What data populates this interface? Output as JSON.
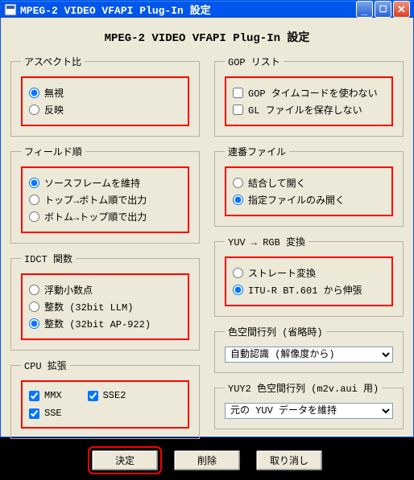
{
  "window": {
    "title": "MPEG-2 VIDEO VFAPI Plug-In 設定"
  },
  "page_title": "MPEG-2 VIDEO VFAPI Plug-In 設定",
  "aspect": {
    "legend": "アスペクト比",
    "opt_ignore": "無視",
    "opt_reflect": "反映"
  },
  "field_order": {
    "legend": "フィールド順",
    "opt_source": "ソースフレームを維持",
    "opt_tb": "トップ→ボトム順で出力",
    "opt_bt": "ボトム→トップ順で出力"
  },
  "idct": {
    "legend": "IDCT 関数",
    "opt_float": "浮動小数点",
    "opt_int32llm": "整数 (32bit LLM)",
    "opt_int32ap": "整数 (32bit AP-922)"
  },
  "cpu": {
    "legend": "CPU 拡張",
    "mmx": "MMX",
    "sse2": "SSE2",
    "sse": "SSE"
  },
  "gop": {
    "legend": "GOP リスト",
    "no_timecode": "GOP タイムコードを使わない",
    "no_save_gl": "GL ファイルを保存しない"
  },
  "renban": {
    "legend": "連番ファイル",
    "opt_join": "結合して開く",
    "opt_only": "指定ファイルのみ開く"
  },
  "yuvrgb": {
    "legend": "YUV → RGB 変換",
    "opt_straight": "ストレート変換",
    "opt_bt601": "ITU-R BT.601 から伸張"
  },
  "matrix_ellipsis": {
    "legend": "色空間行列 (省略時)",
    "selected": "自動認識 (解像度から)"
  },
  "matrix_yuy2": {
    "legend": "YUY2 色空間行列 (m2v.aui 用)",
    "selected": "元の YUV データを維持"
  },
  "buttons": {
    "ok": "決定",
    "delete": "削除",
    "cancel": "取り消し"
  }
}
